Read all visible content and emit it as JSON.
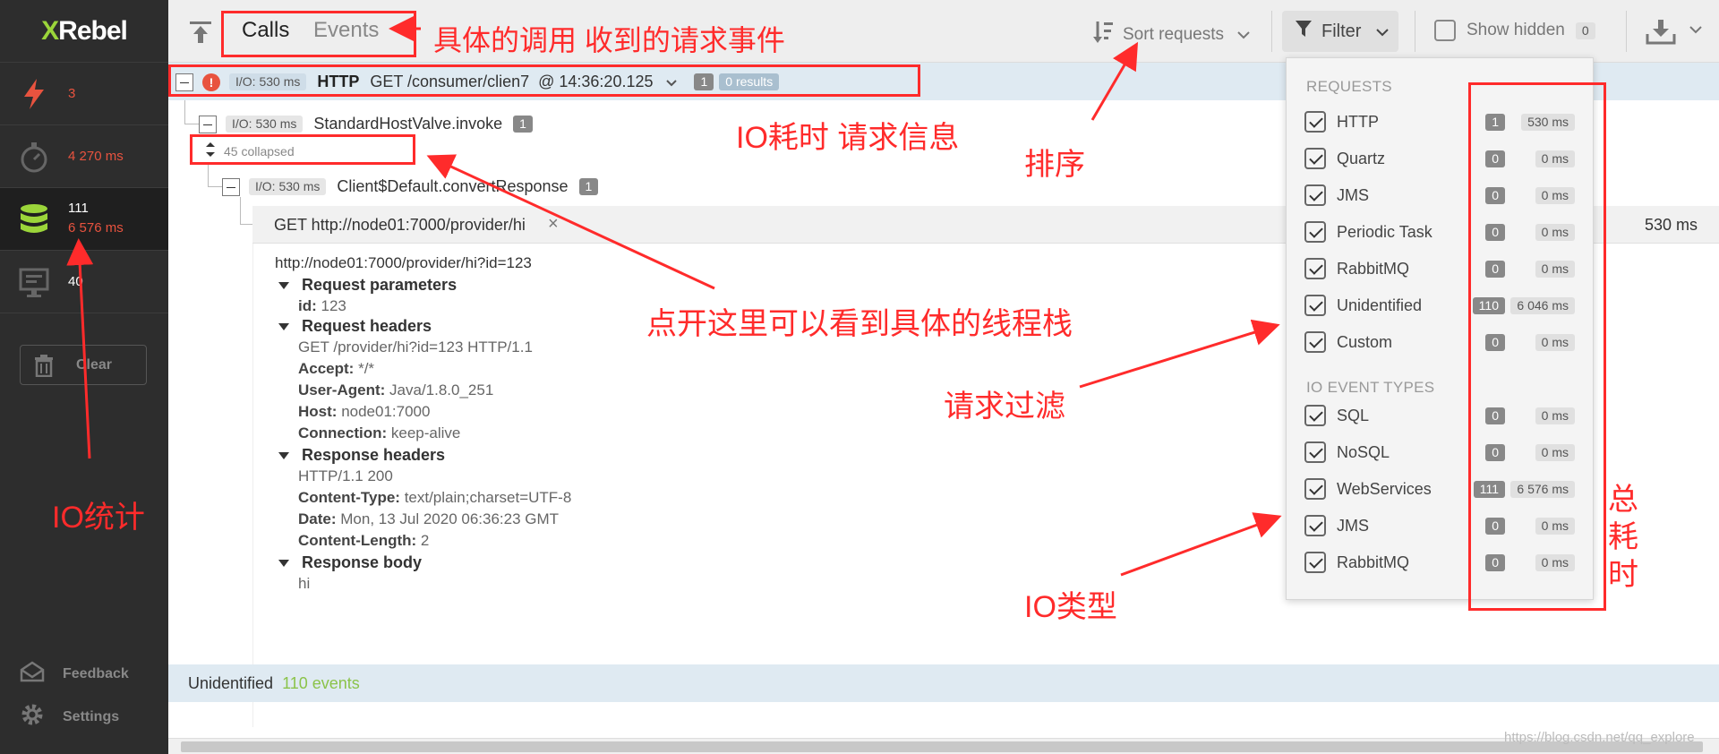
{
  "app": {
    "logo_x": "X",
    "logo_rebel": "Rebel"
  },
  "sidebar": {
    "items": [
      {
        "icon": "lightning-icon",
        "value": "3"
      },
      {
        "icon": "stopwatch-icon",
        "value": "4 270 ms"
      },
      {
        "icon": "database-icon",
        "value_count": "111",
        "value_ms": "6 576 ms"
      },
      {
        "icon": "monitor-icon",
        "value": "40"
      }
    ],
    "clear_label": "Clear",
    "feedback_label": "Feedback",
    "settings_label": "Settings"
  },
  "toolbar": {
    "tabs": [
      "Calls",
      "Events"
    ],
    "sort_label": "Sort requests",
    "filter_label": "Filter",
    "show_hidden_label": "Show hidden",
    "show_hidden_count": "0"
  },
  "tree": {
    "root": {
      "io": "I/O: 530 ms",
      "protocol": "HTTP",
      "request": "GET /consumer/clien7",
      "at": "@ 14:36:20.125",
      "count": "1",
      "results": "0 results"
    },
    "node1": {
      "io": "I/O: 530 ms",
      "name": "StandardHostValve.invoke",
      "count": "1"
    },
    "collapsed": "45 collapsed",
    "node2": {
      "io": "I/O: 530 ms",
      "name": "Client$Default.convertResponse",
      "count": "1"
    },
    "detail": {
      "title": "GET http://node01:7000/provider/hi",
      "duration": "530 ms",
      "url": "http://node01:7000/provider/hi?id=123",
      "request_parameters_label": "Request parameters",
      "param_key": "id:",
      "param_val": "123",
      "request_headers_label": "Request headers",
      "req_line": "GET /provider/hi?id=123 HTTP/1.1",
      "accept_key": "Accept:",
      "accept_val": "*/*",
      "ua_key": "User-Agent:",
      "ua_val": "Java/1.8.0_251",
      "host_key": "Host:",
      "host_val": "node01:7000",
      "conn_key": "Connection:",
      "conn_val": "keep-alive",
      "response_headers_label": "Response headers",
      "resp_line": "HTTP/1.1 200",
      "ct_key": "Content-Type:",
      "ct_val": "text/plain;charset=UTF-8",
      "date_key": "Date:",
      "date_val": "Mon, 13 Jul 2020 06:36:23 GMT",
      "cl_key": "Content-Length:",
      "cl_val": "2",
      "response_body_label": "Response body",
      "body": "hi"
    },
    "footer": {
      "label": "Unidentified",
      "events": "110 events"
    }
  },
  "filter": {
    "requests_heading": "REQUESTS",
    "requests": [
      {
        "name": "HTTP",
        "count": "1",
        "ms": "530 ms"
      },
      {
        "name": "Quartz",
        "count": "0",
        "ms": "0 ms"
      },
      {
        "name": "JMS",
        "count": "0",
        "ms": "0 ms"
      },
      {
        "name": "Periodic Task",
        "count": "0",
        "ms": "0 ms"
      },
      {
        "name": "RabbitMQ",
        "count": "0",
        "ms": "0 ms"
      },
      {
        "name": "Unidentified",
        "count": "110",
        "ms": "6 046 ms"
      },
      {
        "name": "Custom",
        "count": "0",
        "ms": "0 ms"
      }
    ],
    "io_heading": "IO EVENT TYPES",
    "io_types": [
      {
        "name": "SQL",
        "count": "0",
        "ms": "0 ms"
      },
      {
        "name": "NoSQL",
        "count": "0",
        "ms": "0 ms"
      },
      {
        "name": "WebServices",
        "count": "111",
        "ms": "6 576 ms"
      },
      {
        "name": "JMS",
        "count": "0",
        "ms": "0 ms"
      },
      {
        "name": "RabbitMQ",
        "count": "0",
        "ms": "0 ms"
      }
    ]
  },
  "annotations": {
    "calls_events": "具体的调用 收到的请求事件",
    "io_request": "IO耗时 请求信息",
    "sort": "排序",
    "thread_stack": "点开这里可以看到具体的线程栈",
    "request_filter": "请求过滤",
    "io_type": "IO类型",
    "io_stats": "IO统计",
    "total_1": "总",
    "total_2": "耗",
    "total_3": "时"
  },
  "watermark": "https://blog.csdn.net/qq_explore"
}
